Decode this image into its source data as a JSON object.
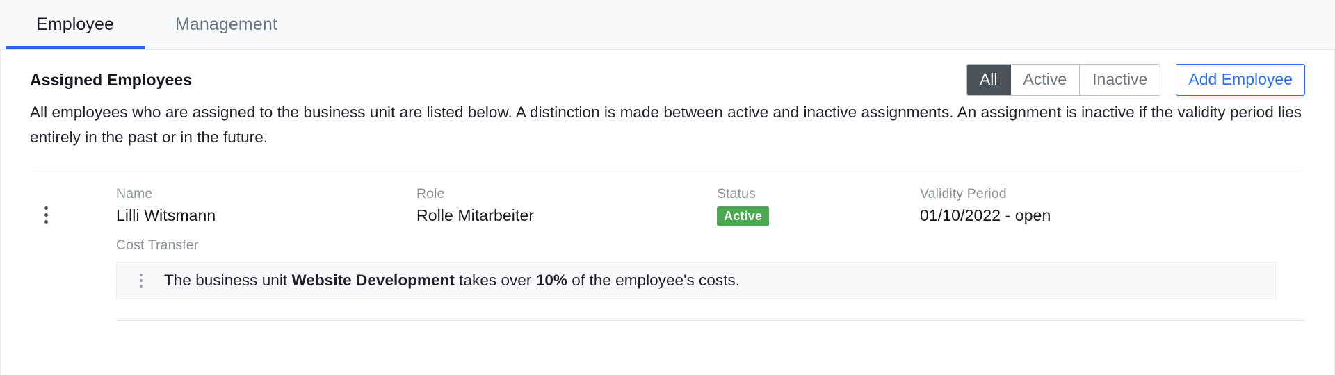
{
  "tabs": [
    {
      "label": "Employee",
      "selected": true
    },
    {
      "label": "Management",
      "selected": false
    }
  ],
  "section": {
    "title": "Assigned Employees",
    "description": "All employees who are assigned to the business unit are listed below. A distinction is made between active and inactive assignments. An assignment is inactive if the validity period lies entirely in the past or in the future."
  },
  "filters": {
    "options": [
      "All",
      "Active",
      "Inactive"
    ],
    "selected": "All",
    "all_label": "All",
    "active_label": "Active",
    "inactive_label": "Inactive"
  },
  "actions": {
    "add_employee_label": "Add Employee"
  },
  "table": {
    "columns": [
      "Name",
      "Role",
      "Status",
      "Validity Period"
    ],
    "col_name": "Name",
    "col_role": "Role",
    "col_status": "Status",
    "col_validity": "Validity Period",
    "rows": [
      {
        "name": "Lilli Witsmann",
        "role": "Rolle Mitarbeiter",
        "status": "Active",
        "validity_period": "01/10/2022 - open",
        "cost_transfer_label": "Cost Transfer",
        "cost_transfer": {
          "prefix": "The business unit ",
          "business_unit": "Website Development",
          "middle": " takes over ",
          "percent": "10%",
          "suffix": " of the employee's costs."
        }
      }
    ]
  },
  "colors": {
    "accent_blue": "#2563eb",
    "link_blue": "#2a6ef0",
    "status_green": "#49a850",
    "segment_selected": "#4a5159",
    "muted_text": "#8b929a"
  }
}
